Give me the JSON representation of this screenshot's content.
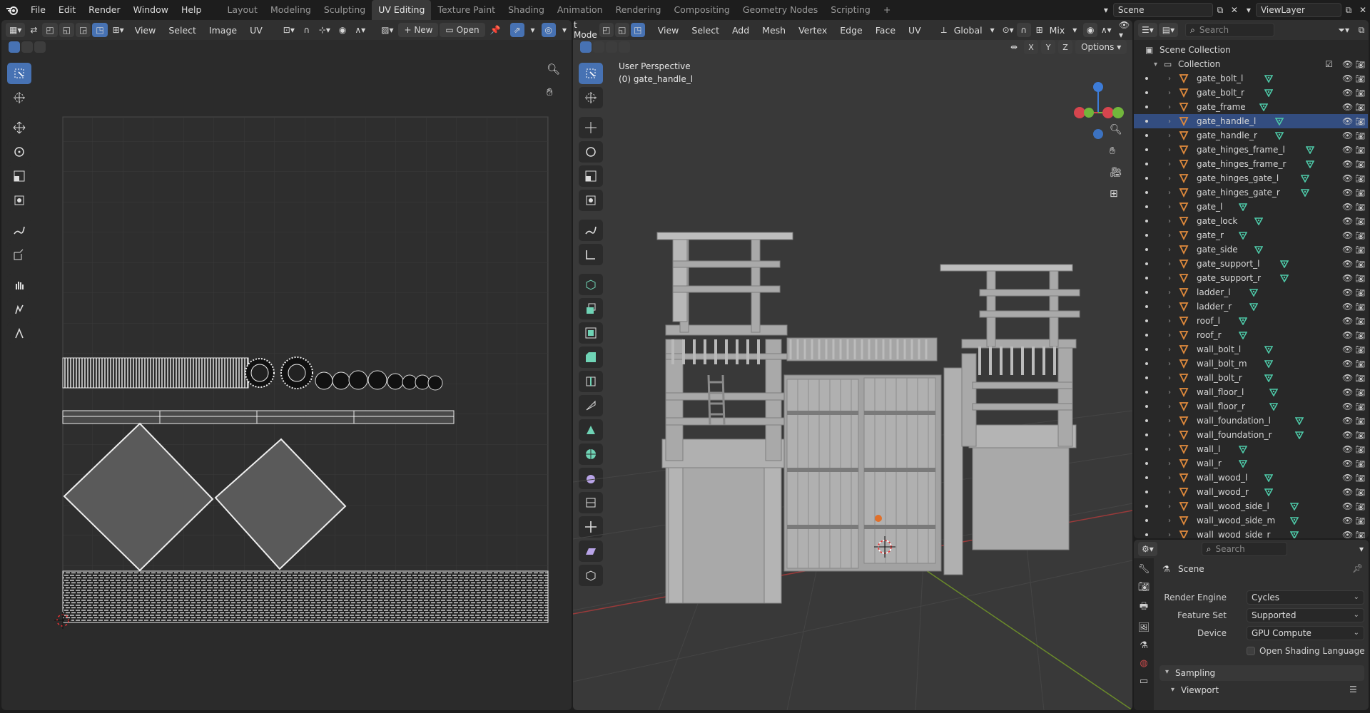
{
  "menu": {
    "items": [
      "File",
      "Edit",
      "Render",
      "Window",
      "Help"
    ],
    "workspaces": [
      "Layout",
      "Modeling",
      "Sculpting",
      "UV Editing",
      "Texture Paint",
      "Shading",
      "Animation",
      "Rendering",
      "Compositing",
      "Geometry Nodes",
      "Scripting"
    ],
    "active_workspace": "UV Editing",
    "add_tab": "+",
    "scene_name": "Scene",
    "view_layer": "ViewLayer"
  },
  "uv_editor": {
    "menus": [
      "View",
      "Select",
      "Image",
      "UV"
    ],
    "new_label": "New",
    "open_label": "Open"
  },
  "viewport": {
    "mode_label": "t Mode",
    "menus": [
      "View",
      "Select",
      "Add",
      "Mesh",
      "Vertex",
      "Edge",
      "Face",
      "UV"
    ],
    "orientation": "Global",
    "mix_label": "Mix",
    "options_label": "Options",
    "overlay_title": "User Perspective",
    "overlay_object": "(0) gate_handle_l",
    "axis_letters": [
      "X",
      "Y",
      "Z"
    ],
    "gizmo": {
      "x_color": "#d6454e",
      "y_color": "#72b63c",
      "z_color": "#3d7cd8"
    }
  },
  "outliner": {
    "search_placeholder": "Search",
    "scene_collection": "Scene Collection",
    "collection": "Collection",
    "selected": "gate_handle_l",
    "items": [
      "gate_bolt_l",
      "gate_bolt_r",
      "gate_frame",
      "gate_handle_l",
      "gate_handle_r",
      "gate_hinges_frame_l",
      "gate_hinges_frame_r",
      "gate_hinges_gate_l",
      "gate_hinges_gate_r",
      "gate_l",
      "gate_lock",
      "gate_r",
      "gate_side",
      "gate_support_l",
      "gate_support_r",
      "ladder_l",
      "ladder_r",
      "roof_l",
      "roof_r",
      "wall_bolt_l",
      "wall_bolt_m",
      "wall_bolt_r",
      "wall_floor_l",
      "wall_floor_r",
      "wall_foundation_l",
      "wall_foundation_r",
      "wall_l",
      "wall_r",
      "wall_wood_l",
      "wall_wood_r",
      "wall_wood_side_l",
      "wall_wood_side_m",
      "wall_wood_side_r"
    ]
  },
  "properties": {
    "search_placeholder": "Search",
    "title": "Scene",
    "render_engine_label": "Render Engine",
    "render_engine_value": "Cycles",
    "feature_set_label": "Feature Set",
    "feature_set_value": "Supported",
    "device_label": "Device",
    "device_value": "GPU Compute",
    "osl_label": "Open Shading Language",
    "sampling_label": "Sampling",
    "viewport_label": "Viewport"
  },
  "colors": {
    "accent": "#4772b3",
    "selection": "#334d80",
    "mesh_icon": "#e08a3c",
    "data_icon": "#4ec9a8"
  }
}
